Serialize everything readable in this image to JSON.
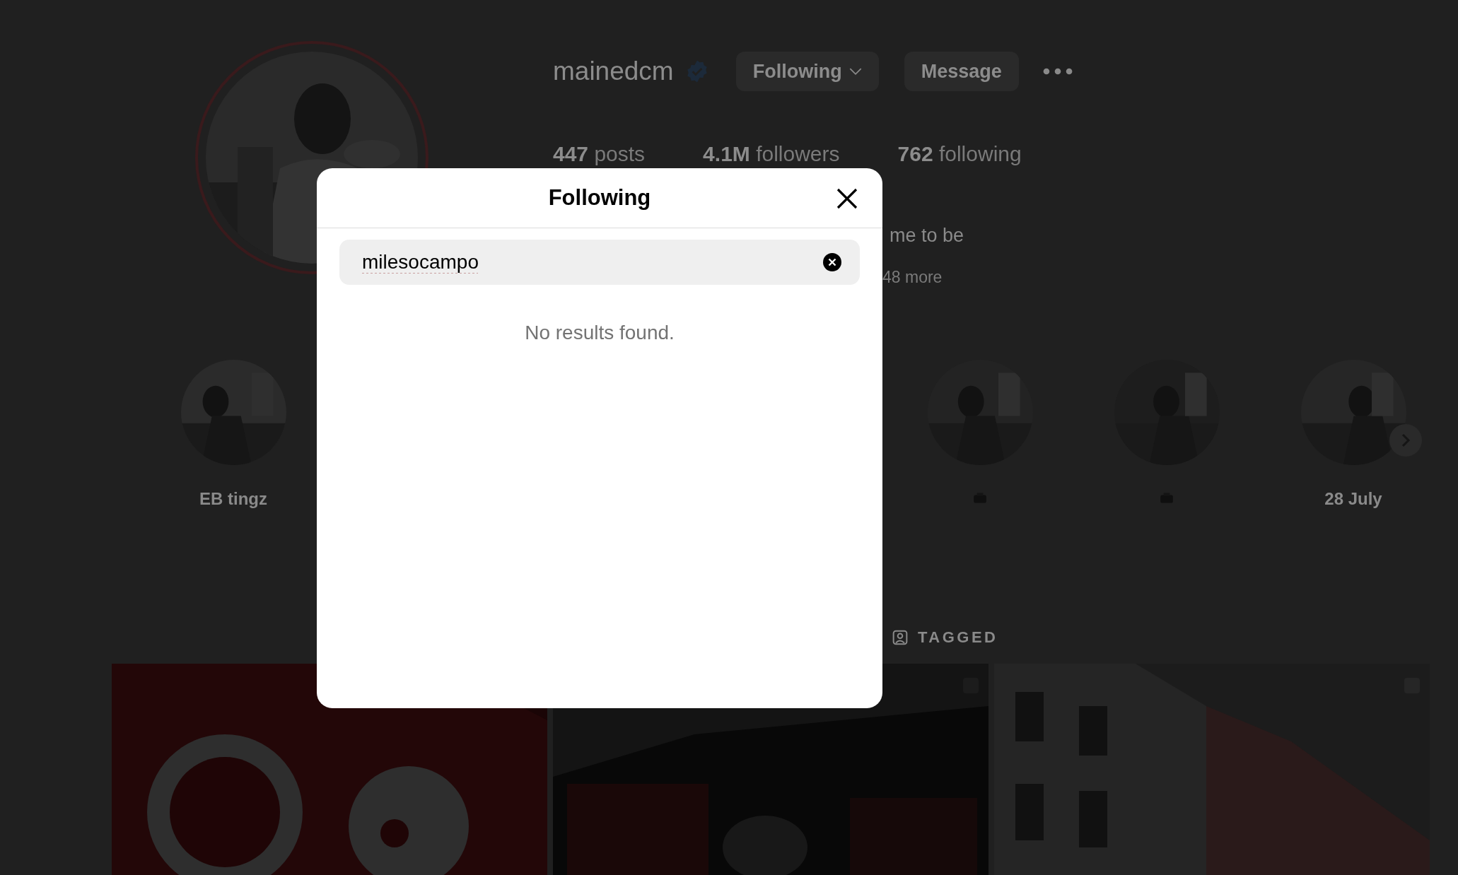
{
  "profile": {
    "username": "mainedcm",
    "verified": true,
    "buttons": [
      {
        "label": "Following",
        "kind": "dropdown"
      },
      {
        "label": "Message",
        "kind": "plain"
      }
    ],
    "stats": [
      {
        "count": "447",
        "label": "posts"
      },
      {
        "count": "4.1M",
        "label": "followers"
      },
      {
        "count": "762",
        "label": "following"
      }
    ],
    "bio_line": "me to be",
    "more": "48 more"
  },
  "highlights": [
    {
      "kind": "text",
      "label": "EB tingz"
    },
    {
      "kind": "icon"
    },
    {
      "kind": "icon"
    },
    {
      "kind": "text",
      "label": "28 July"
    }
  ],
  "tabs": [
    {
      "label": "TAGGED"
    }
  ],
  "modal": {
    "title": "Following",
    "search": {
      "value": "milesocampo"
    },
    "empty_message": "No results found."
  }
}
